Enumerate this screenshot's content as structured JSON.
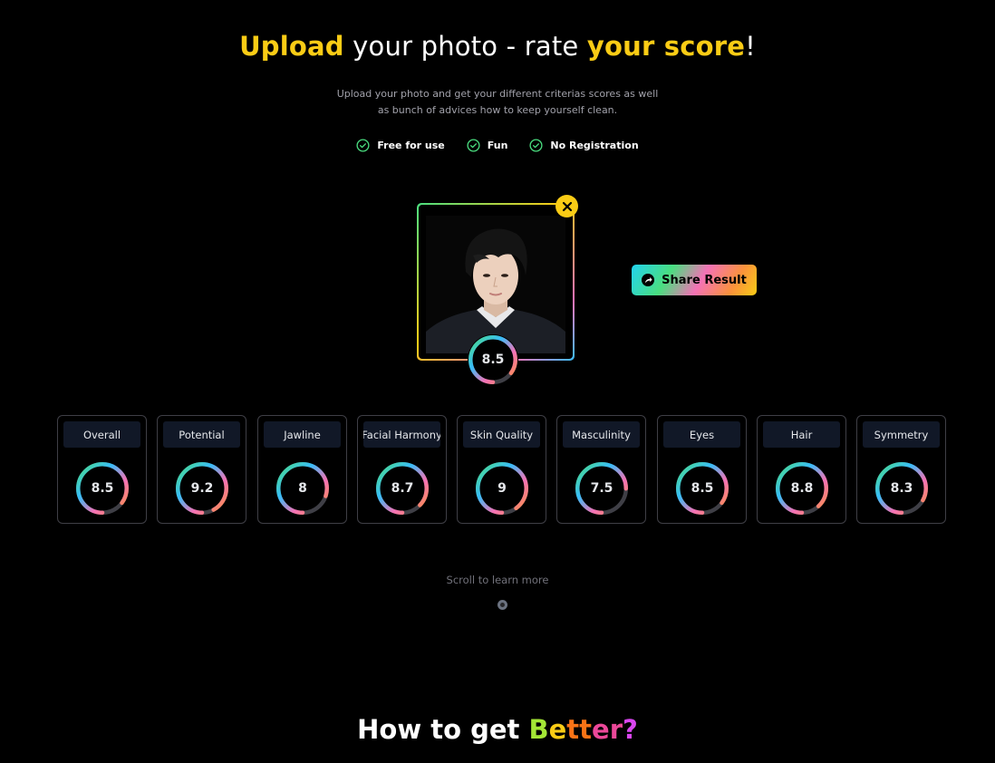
{
  "hero": {
    "title_part1": "Upload",
    "title_part2": " your photo - rate ",
    "title_part3": "your score",
    "title_part4": "!",
    "subtitle_line1": "Upload your photo and get your different criterias scores as well",
    "subtitle_line2": "as bunch of advices how to keep yourself clean."
  },
  "features": [
    {
      "label": "Free for use",
      "icon": "check-circle-icon"
    },
    {
      "label": "Fun",
      "icon": "check-circle-icon"
    },
    {
      "label": "No Registration",
      "icon": "check-circle-icon"
    }
  ],
  "photo": {
    "close_icon": "close-icon",
    "overall_score": "8.5",
    "overall_fraction": 0.85
  },
  "share": {
    "label": "Share Result",
    "icon": "share-arrow-icon"
  },
  "scores": [
    {
      "label": "Overall",
      "value": "8.5",
      "fraction": 0.85
    },
    {
      "label": "Potential",
      "value": "9.2",
      "fraction": 0.92
    },
    {
      "label": "Jawline",
      "value": "8",
      "fraction": 0.8
    },
    {
      "label": "Facial Harmony",
      "value": "8.7",
      "fraction": 0.87
    },
    {
      "label": "Skin Quality",
      "value": "9",
      "fraction": 0.9
    },
    {
      "label": "Masculinity",
      "value": "7.5",
      "fraction": 0.75
    },
    {
      "label": "Eyes",
      "value": "8.5",
      "fraction": 0.85
    },
    {
      "label": "Hair",
      "value": "8.8",
      "fraction": 0.88
    },
    {
      "label": "Symmetry",
      "value": "8.3",
      "fraction": 0.83
    }
  ],
  "scroll": {
    "label": "Scroll to learn more"
  },
  "better": {
    "part1": "How to get ",
    "b": "B",
    "e1": "e",
    "tt": "tt",
    "e2": "e",
    "r": "r",
    "q": "?"
  },
  "colors": {
    "accent": "#facc15",
    "check": "#4ade80",
    "ring_track": "#3f3f46"
  }
}
